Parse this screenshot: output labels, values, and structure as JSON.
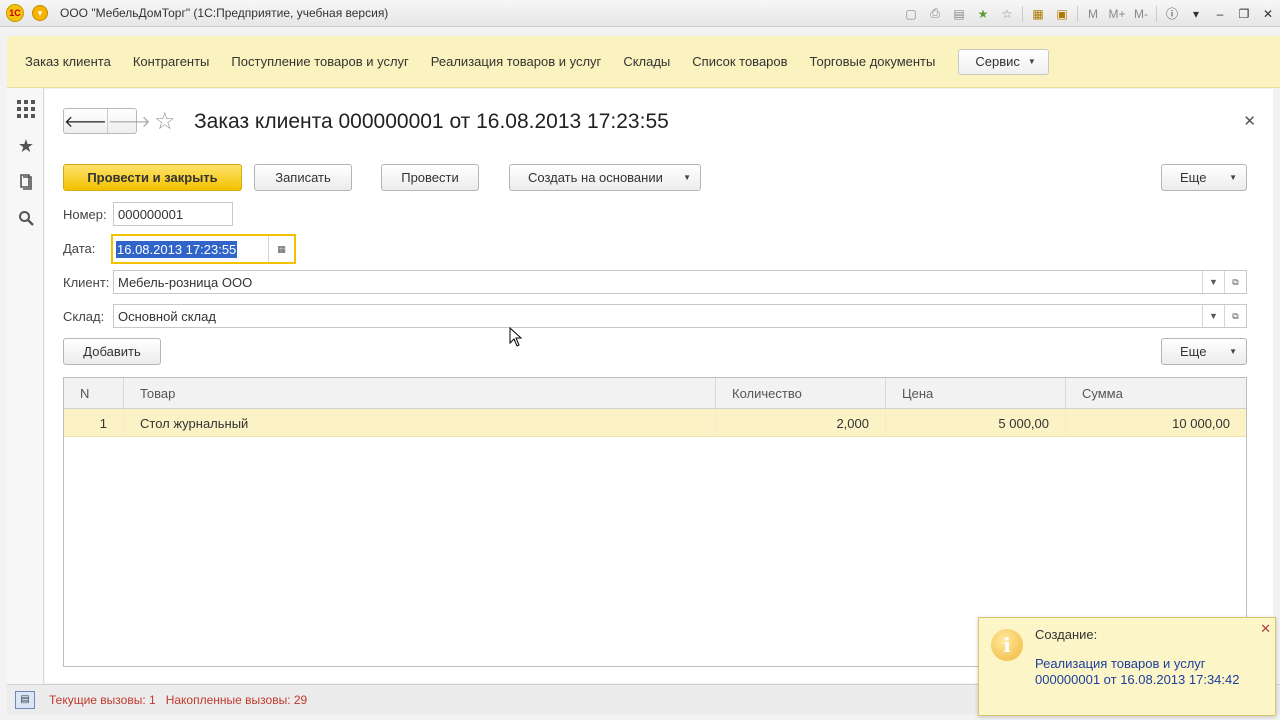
{
  "window": {
    "title": "ООО \"МебельДомТорг\"  (1С:Предприятие, учебная версия)",
    "logo_text": "1С",
    "toolbar_icons": [
      "save-icon",
      "print-icon",
      "favorites-icon",
      "bookmark-icon",
      "calculator-icon",
      "calendar-icon",
      "M",
      "M+",
      "M-",
      "info-icon",
      "dropdown-icon",
      "minimize-icon",
      "restore-icon",
      "close-icon"
    ],
    "mem_labels": [
      "M",
      "M+",
      "M-"
    ]
  },
  "sections": {
    "items": [
      "Заказ клиента",
      "Контрагенты",
      "Поступление товаров и услуг",
      "Реализация товаров и услуг",
      "Склады",
      "Список товаров",
      "Торговые документы"
    ],
    "service_label": "Сервис"
  },
  "form": {
    "title": "Заказ клиента 000000001 от 16.08.2013 17:23:55",
    "buttons": {
      "post_close": "Провести и закрыть",
      "write": "Записать",
      "post": "Провести",
      "create_based": "Создать на основании",
      "more": "Еще",
      "add": "Добавить",
      "more_table": "Еще"
    },
    "fields": {
      "number_label": "Номер:",
      "number_value": "000000001",
      "date_label": "Дата:",
      "date_value": "16.08.2013 17:23:55",
      "client_label": "Клиент:",
      "client_value": "Мебель-розница ООО",
      "warehouse_label": "Склад:",
      "warehouse_value": "Основной склад"
    },
    "table": {
      "columns": [
        "N",
        "Товар",
        "Количество",
        "Цена",
        "Сумма"
      ],
      "rows": [
        {
          "n": "1",
          "product": "Стол журнальный",
          "qty": "2,000",
          "price": "5 000,00",
          "sum": "10 000,00"
        }
      ]
    }
  },
  "status": {
    "current_calls": "Текущие вызовы: 1",
    "accumulated_calls": "Накопленные вызовы: 29"
  },
  "notification": {
    "title": "Создание:",
    "link_line1": "Реализация товаров и услуг",
    "link_line2": "000000001 от 16.08.2013 17:34:42"
  },
  "colors": {
    "accent_yellow": "#f2c200",
    "sections_bg": "#fbf3bf",
    "selected_row": "#fbf3c6",
    "status_red": "#c0392b",
    "link_blue": "#1d3f9e"
  }
}
